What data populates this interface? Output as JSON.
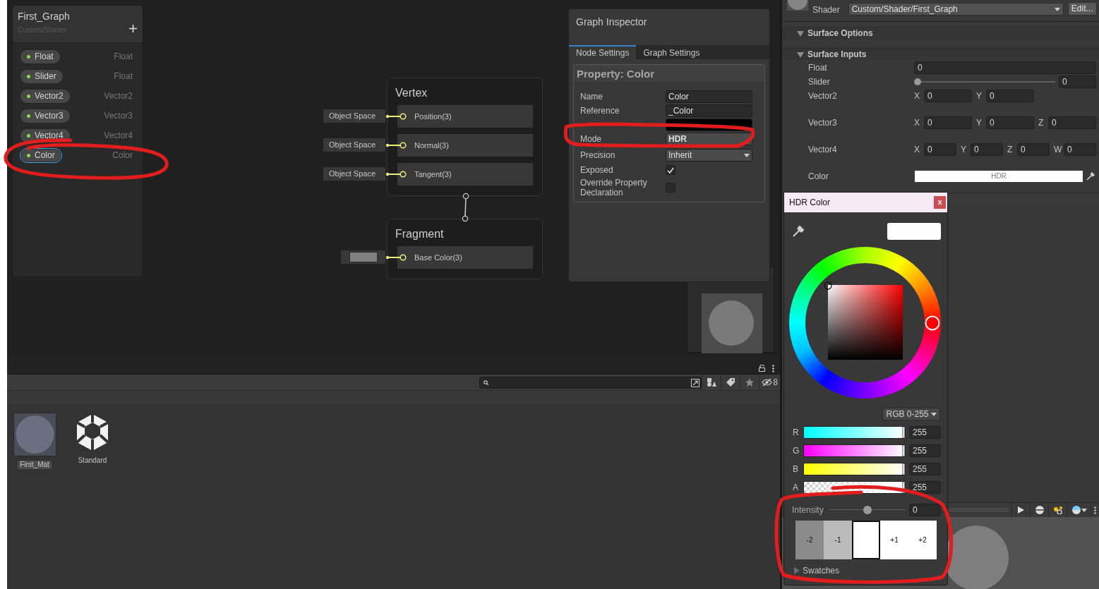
{
  "blackboard": {
    "title": "First_Graph",
    "subtitle": "Custom/Shader",
    "properties": [
      {
        "name": "Float",
        "type": "Float",
        "selected": false
      },
      {
        "name": "Slider",
        "type": "Float",
        "selected": false
      },
      {
        "name": "Vector2",
        "type": "Vector2",
        "selected": false
      },
      {
        "name": "Vector3",
        "type": "Vector3",
        "selected": false
      },
      {
        "name": "Vector4",
        "type": "Vector4",
        "selected": false
      },
      {
        "name": "Color",
        "type": "Color",
        "selected": true
      }
    ]
  },
  "master_stack": {
    "vertex": {
      "title": "Vertex",
      "ports": [
        {
          "kind": "space",
          "input": "Object Space",
          "label": "Position(3)"
        },
        {
          "kind": "space",
          "input": "Object Space",
          "label": "Normal(3)"
        },
        {
          "kind": "space",
          "input": "Object Space",
          "label": "Tangent(3)"
        }
      ]
    },
    "fragment": {
      "title": "Fragment",
      "ports": [
        {
          "kind": "color",
          "label": "Base Color(3)"
        }
      ]
    }
  },
  "graph_inspector": {
    "title": "Graph Inspector",
    "tabs": [
      {
        "label": "Node Settings",
        "selected": true
      },
      {
        "label": "Graph Settings",
        "selected": false
      }
    ],
    "section_title": "Property: Color",
    "fields": [
      {
        "kind": "text",
        "label": "Name",
        "value": "Color"
      },
      {
        "kind": "text",
        "label": "Reference",
        "value": "_Color"
      },
      {
        "kind": "swatch"
      },
      {
        "kind": "readonly",
        "label": "Mode",
        "value": "HDR"
      },
      {
        "kind": "dropdown",
        "label": "Precision",
        "value": "Inherit"
      },
      {
        "kind": "checkbox",
        "label": "Exposed",
        "checked": true
      },
      {
        "kind": "checkbox",
        "label": "Override Property Declaration",
        "checked": false
      }
    ]
  },
  "project": {
    "hidden_count": "8",
    "assets": [
      {
        "kind": "material",
        "name": "First_Mat",
        "selected": true
      },
      {
        "kind": "shader",
        "name": "Standard",
        "selected": false
      }
    ]
  },
  "material_inspector": {
    "shader_label": "Shader",
    "shader_value": "Custom/Shader/First_Graph",
    "edit_button": "Edit...",
    "sections": [
      {
        "title": "Surface Options",
        "expanded": true
      },
      {
        "title": "Surface Inputs",
        "expanded": true
      }
    ],
    "inputs": [
      {
        "kind": "float",
        "label": "Float",
        "value": "0"
      },
      {
        "kind": "slider",
        "label": "Slider",
        "level": 0,
        "value": "0"
      },
      {
        "kind": "vector",
        "label": "Vector2",
        "components": [
          {
            "axis": "X",
            "value": "0"
          },
          {
            "axis": "Y",
            "value": "0"
          }
        ]
      },
      {
        "kind": "vector",
        "label": "Vector3",
        "components": [
          {
            "axis": "X",
            "value": "0"
          },
          {
            "axis": "Y",
            "value": "0"
          },
          {
            "axis": "Z",
            "value": "0"
          }
        ]
      },
      {
        "kind": "vector",
        "label": "Vector4",
        "components": [
          {
            "axis": "X",
            "value": "0"
          },
          {
            "axis": "Y",
            "value": "0"
          },
          {
            "axis": "Z",
            "value": "0"
          },
          {
            "axis": "W",
            "value": "0"
          }
        ]
      },
      {
        "kind": "color",
        "label": "Color",
        "value": "HDR"
      }
    ]
  },
  "color_picker": {
    "title": "HDR Color",
    "close": "x",
    "mode": "RGB 0-255",
    "channels": [
      {
        "kind": "red",
        "name": "R",
        "level": 1,
        "value": "255"
      },
      {
        "kind": "green",
        "name": "G",
        "level": 1,
        "value": "255"
      },
      {
        "kind": "blue",
        "name": "B",
        "level": 1,
        "value": "255"
      },
      {
        "kind": "alpha",
        "name": "A",
        "level": 1,
        "value": "255"
      }
    ],
    "intensity": {
      "label": "Intensity",
      "level": 0.5,
      "value": "0"
    },
    "exposure_swatches": [
      {
        "label": "-2",
        "color": "#8a8a8a",
        "selected": false
      },
      {
        "label": "-1",
        "color": "#bababa",
        "selected": false
      },
      {
        "color": "#ffffff",
        "selected": true
      },
      {
        "label": "+1",
        "color": "#ffffff",
        "selected": false
      },
      {
        "label": "+2",
        "color": "#ffffff",
        "selected": false
      }
    ],
    "swatches": {
      "label": "Swatches",
      "expanded": false
    }
  }
}
